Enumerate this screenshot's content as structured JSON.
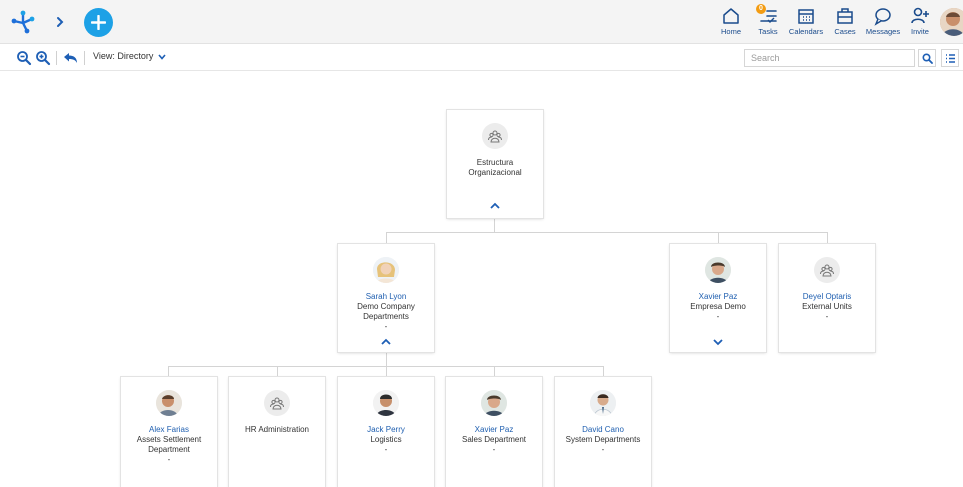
{
  "header": {
    "nav": [
      {
        "key": "home",
        "label": "Home",
        "icon": "home-icon"
      },
      {
        "key": "tasks",
        "label": "Tasks",
        "icon": "tasks-icon",
        "badge": "0"
      },
      {
        "key": "calendars",
        "label": "Calendars",
        "icon": "calendar-icon"
      },
      {
        "key": "cases",
        "label": "Cases",
        "icon": "briefcase-icon"
      },
      {
        "key": "messages",
        "label": "Messages",
        "icon": "chat-bubble-icon"
      },
      {
        "key": "invite",
        "label": "Invite",
        "icon": "add-user-icon"
      }
    ],
    "accent_color": "#1da1e6",
    "nav_text_color": "#1a4b8c"
  },
  "toolbar": {
    "view_label": "View: Directory",
    "search_placeholder": "Search"
  },
  "org": {
    "root": {
      "name": "Estructura Organizacional",
      "type": "unit"
    },
    "level1": [
      {
        "name": "Sarah Lyon",
        "dept": "Demo Company Departments",
        "extra": "-",
        "type": "person"
      },
      {
        "name": "Xavier Paz",
        "dept": "Empresa Demo",
        "extra": "-",
        "type": "person"
      },
      {
        "name": "Deyel Optaris",
        "dept": "External Units",
        "extra": "-",
        "type": "unit"
      }
    ],
    "level2": [
      {
        "name": "Alex Farias",
        "dept": "Assets Settlement Department",
        "extra": "-",
        "type": "person"
      },
      {
        "name": "HR Administration",
        "dept": "",
        "extra": "",
        "type": "unit"
      },
      {
        "name": "Jack Perry",
        "dept": "Logistics",
        "extra": "-",
        "type": "person"
      },
      {
        "name": "Xavier Paz",
        "dept": "Sales Department",
        "extra": "-",
        "type": "person"
      },
      {
        "name": "David Cano",
        "dept": "System Departments",
        "extra": "-",
        "type": "person"
      }
    ]
  }
}
